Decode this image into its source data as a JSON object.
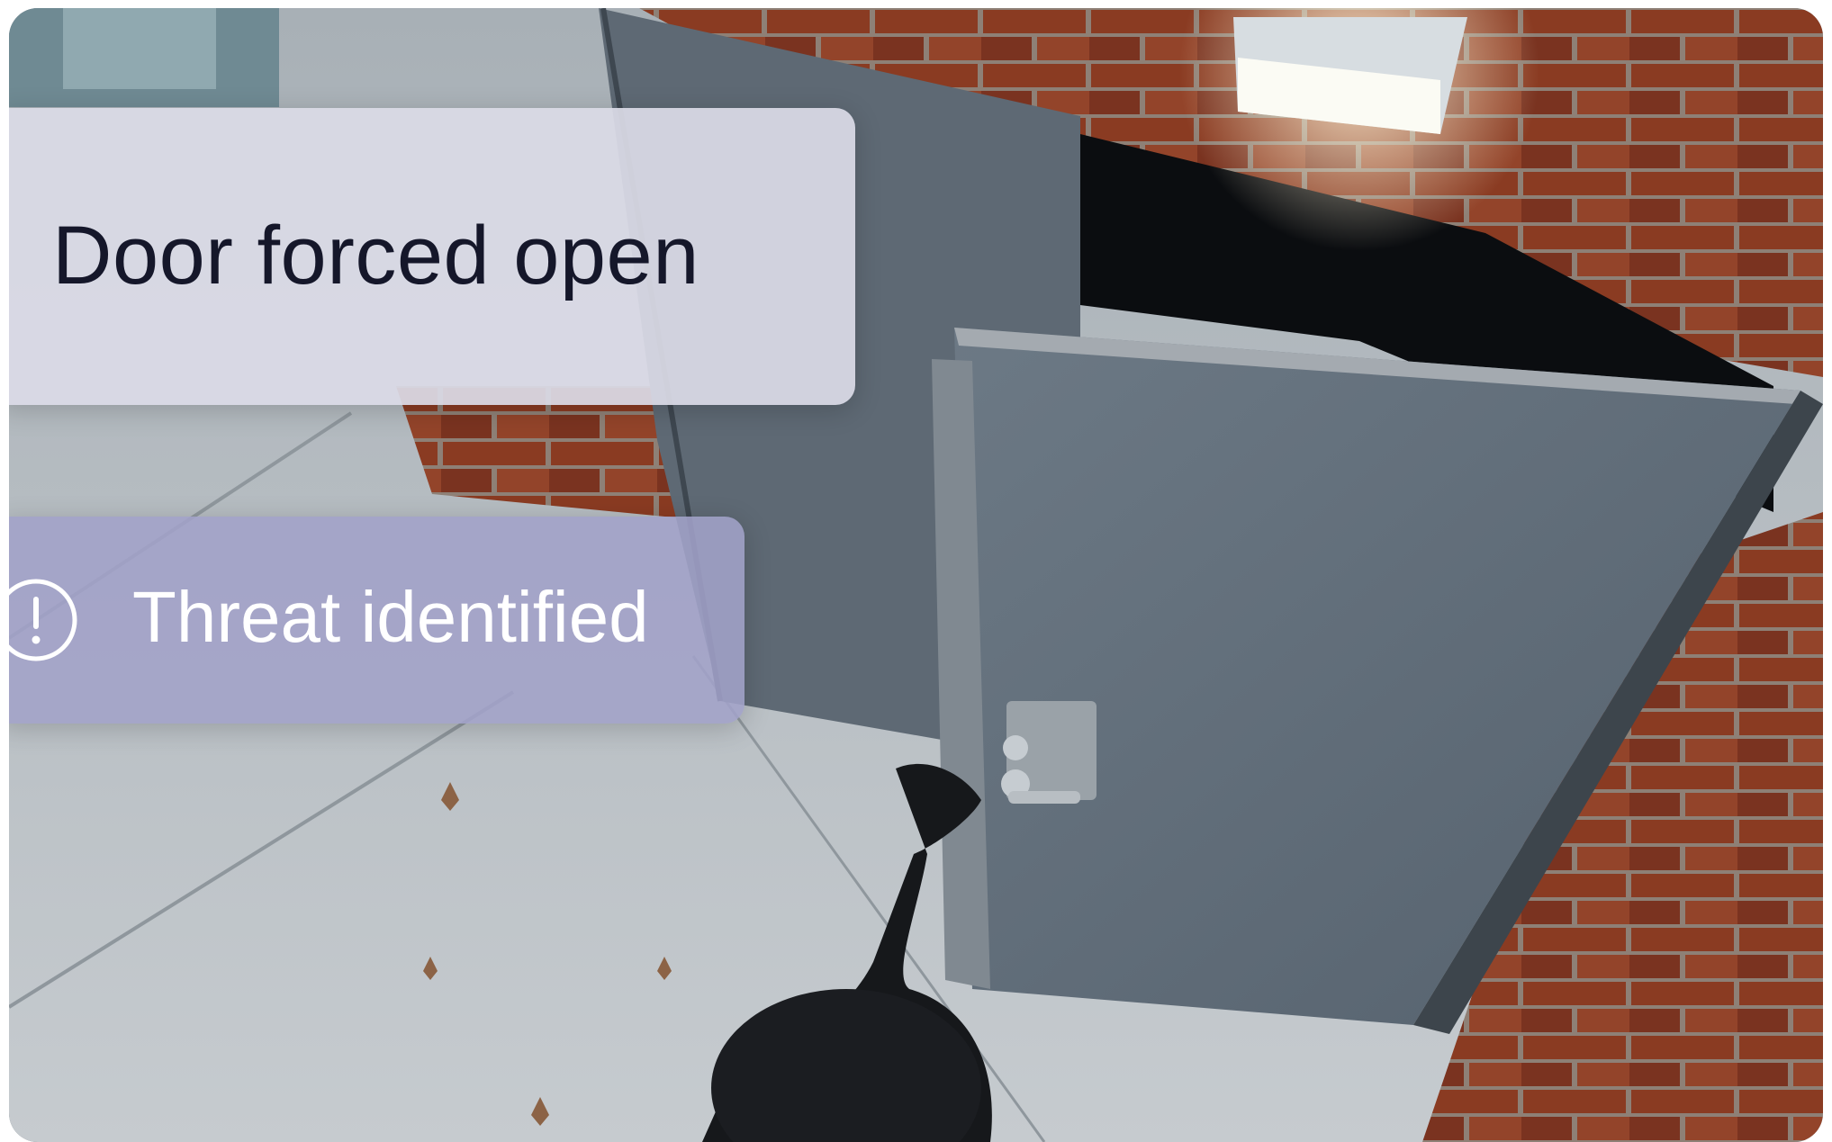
{
  "alert": {
    "title": "Door forced open"
  },
  "threat": {
    "label": "Threat identified",
    "icon": "exclamation-circle-icon"
  },
  "colors": {
    "alert_card_bg": "#dadae6",
    "alert_text": "#15172a",
    "threat_card_bg": "#a2a2c8",
    "threat_text": "#ffffff"
  }
}
